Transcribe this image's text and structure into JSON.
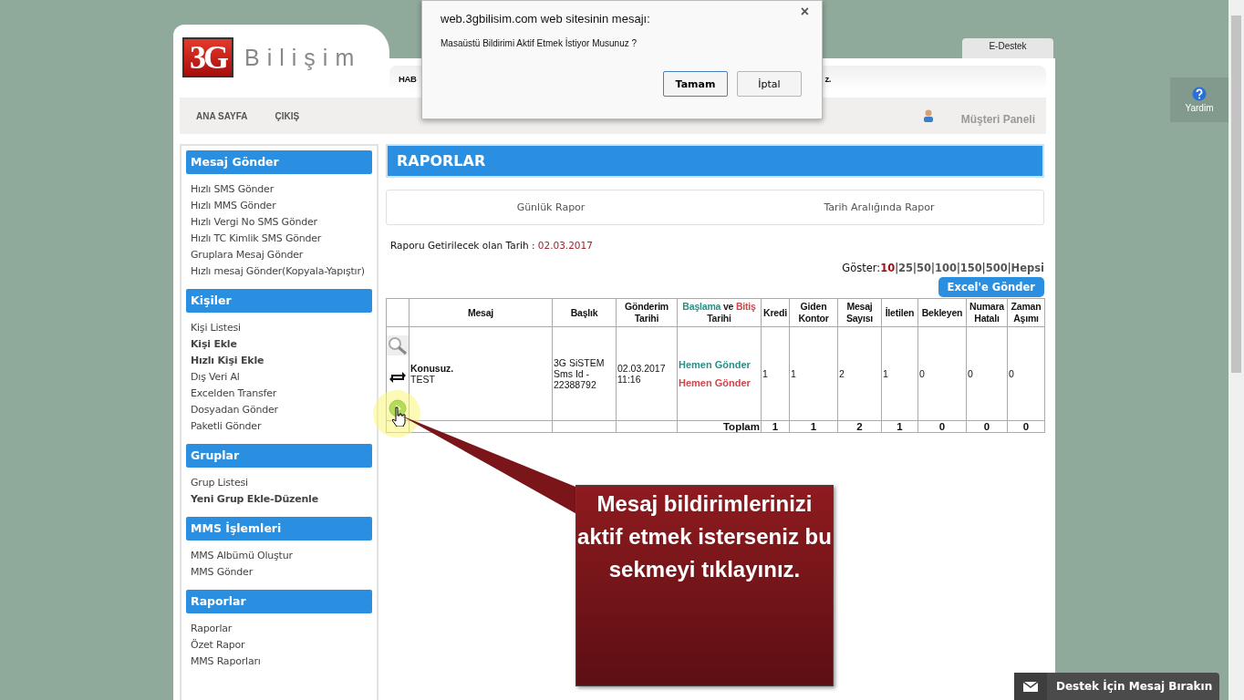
{
  "dialog": {
    "title": "web.3gbilisim.com web sitesinin mesajı:",
    "message": "Masaüstü Bildirimi Aktif Etmek İstiyor Musunuz ?",
    "close": "×",
    "buttons": [
      {
        "label": "Tamam",
        "selected": true
      },
      {
        "label": "İptal",
        "selected": false
      }
    ]
  },
  "header": {
    "logo_mark": "3G",
    "logo_text": "Bilişim",
    "ticker": [
      "HAB",
      "z."
    ],
    "tab": "E-Destek"
  },
  "nav": {
    "items": [
      "ANA SAYFA",
      "ÇIKIŞ"
    ],
    "customer_panel": "Müşteri Paneli"
  },
  "help": "Yardim",
  "sidebar": [
    {
      "title": "Mesaj Gönder",
      "items": [
        {
          "label": "Hızlı SMS Gönder",
          "bold": false
        },
        {
          "label": "Hızlı MMS Gönder",
          "bold": false
        },
        {
          "label": "Hızlı Vergi No SMS Gönder",
          "bold": false
        },
        {
          "label": "Hızlı TC Kimlik SMS Gönder",
          "bold": false
        },
        {
          "label": "Gruplara Mesaj Gönder",
          "bold": false
        },
        {
          "label": "Hızlı mesaj Gönder(Kopyala-Yapıştır)",
          "bold": false
        }
      ]
    },
    {
      "title": "Kişiler",
      "items": [
        {
          "label": "Kişi Listesi",
          "bold": false
        },
        {
          "label": "Kişi Ekle",
          "bold": true
        },
        {
          "label": "Hızlı Kişi Ekle",
          "bold": true
        },
        {
          "label": "Dış Veri Al",
          "bold": false
        },
        {
          "label": "Excelden Transfer",
          "bold": false
        },
        {
          "label": "Dosyadan Gönder",
          "bold": false
        },
        {
          "label": "Paketli Gönder",
          "bold": false
        }
      ]
    },
    {
      "title": "Gruplar",
      "items": [
        {
          "label": "Grup Listesi",
          "bold": false
        },
        {
          "label": "Yeni Grup Ekle-Düzenle",
          "bold": true
        }
      ]
    },
    {
      "title": "MMS İşlemleri",
      "items": [
        {
          "label": "MMS Albümü Oluştur",
          "bold": false
        },
        {
          "label": "MMS Gönder",
          "bold": false
        }
      ]
    },
    {
      "title": "Raporlar",
      "items": [
        {
          "label": "Raporlar",
          "bold": false
        },
        {
          "label": "Özet Rapor",
          "bold": false
        },
        {
          "label": "MMS Raporları",
          "bold": false
        }
      ]
    }
  ],
  "main": {
    "title": "RAPORLAR",
    "report_tabs": [
      "Günlük Rapor",
      "Tarih Aralığında Rapor"
    ],
    "date_label": "Raporu Getirilecek olan Tarih :",
    "date_value": "02.03.2017",
    "page_size": {
      "label": "Göster:",
      "separator": "|",
      "options": [
        {
          "label": "10",
          "selected": true
        },
        {
          "label": "25",
          "selected": false
        },
        {
          "label": "50",
          "selected": false
        },
        {
          "label": "100",
          "selected": false
        },
        {
          "label": "150",
          "selected": false
        },
        {
          "label": "500",
          "selected": false
        },
        {
          "label": "Hepsi",
          "selected": false
        }
      ]
    },
    "export_button": "Excel'e Gönder",
    "columns": [
      {
        "parts": [
          {
            "text": "Mesaj"
          }
        ]
      },
      {
        "parts": [
          {
            "text": "Başlık"
          }
        ]
      },
      {
        "parts": [
          {
            "text": "Gönderim Tarihi"
          }
        ]
      },
      {
        "parts": [
          {
            "text": "Başlama",
            "color": "#2a8f86"
          },
          {
            "text": "ve",
            "color": "#222222"
          },
          {
            "text": "Bitiş",
            "color": "#d0464a"
          },
          {
            "text": "Tarihi",
            "color": "#222222"
          }
        ]
      },
      {
        "parts": [
          {
            "text": "Kredi"
          }
        ]
      },
      {
        "parts": [
          {
            "text": "Giden Kontor"
          }
        ]
      },
      {
        "parts": [
          {
            "text": "Mesaj Sayısı"
          }
        ]
      },
      {
        "parts": [
          {
            "text": "İletilen"
          }
        ]
      },
      {
        "parts": [
          {
            "text": "Bekleyen"
          }
        ]
      },
      {
        "parts": [
          {
            "text": "Numara Hatalı"
          }
        ]
      },
      {
        "parts": [
          {
            "text": "Zaman Aşımı"
          }
        ]
      }
    ],
    "rows": [
      {
        "message_title": "Konusuz.",
        "message_text": "TEST",
        "subject": "3G SiSTEM Sms Id - 22388792",
        "send_date": "02.03.2017 11:16",
        "start": "Hemen Gönder",
        "end": "Hemen Gönder",
        "values": [
          "1",
          "1",
          "2",
          "1",
          "0",
          "0",
          "0"
        ]
      }
    ],
    "totals": {
      "label": "Toplam",
      "values": [
        "1",
        "1",
        "2",
        "1",
        "0",
        "0",
        "0"
      ]
    }
  },
  "callout": "Mesaj bildirimlerinizi aktif etmek isterseniz bu sekmeyi tıklayınız.",
  "chat_button": "Destek İçin Mesaj Bırakın"
}
